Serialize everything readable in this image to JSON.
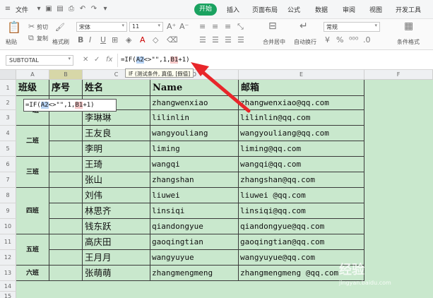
{
  "menubar": {
    "file": "文件",
    "tabs": [
      "开始",
      "插入",
      "页面布局",
      "公式",
      "数据",
      "审阅",
      "视图",
      "开发工具"
    ]
  },
  "ribbon": {
    "paste": "粘贴",
    "cut": "剪切",
    "copy": "复制",
    "format_painter": "格式刷",
    "font": "宋体",
    "size": "11",
    "merge": "合并居中",
    "wrap": "自动换行",
    "number_format": "常规",
    "cond_format": "条件格式"
  },
  "formula_bar": {
    "name_box": "SUBTOTAL",
    "fx": "fx",
    "formula_prefix": "=IF(",
    "ref_a": "A2",
    "formula_mid": "<>\"\",1,",
    "ref_b": "B1",
    "formula_suffix": "+1)"
  },
  "tooltip": "IF (测试条件, 真值, [假值]",
  "grid": {
    "columns": [
      "A",
      "B",
      "C",
      "D",
      "E",
      "F"
    ],
    "rows": [
      "1",
      "2",
      "3",
      "4",
      "5",
      "6",
      "7",
      "8",
      "9",
      "10",
      "11",
      "12",
      "13",
      "14",
      "15"
    ],
    "headers": [
      "班级",
      "序号",
      "姓名",
      "Name",
      "邮箱"
    ],
    "edit_cell": {
      "prefix": "=IF(",
      "ref_a": "A2",
      "mid": "<>\"\",1,",
      "ref_b": "B1",
      "suffix": "+1)"
    },
    "classes": [
      "一班",
      "二班",
      "三班",
      "四班",
      "五班",
      "六班"
    ],
    "data": [
      [
        "",
        "zhangwenxiao",
        "zhangwenxiao@qq.com"
      ],
      [
        "李琳琳",
        "lilinlin",
        "lilinlin@qq.com"
      ],
      [
        "王友良",
        "wangyouliang",
        "wangyouliang@qq.com"
      ],
      [
        "李明",
        "liming",
        "liming@qq.com"
      ],
      [
        "王琦",
        "wangqi",
        "wangqi@qq.com"
      ],
      [
        "张山",
        "zhangshan",
        "zhangshan@qq.com"
      ],
      [
        "刘伟",
        "liuwei",
        "liuwei @qq.com"
      ],
      [
        "林思齐",
        "linsiqi",
        "linsiqi@qq.com"
      ],
      [
        "钱东跃",
        "qiandongyue",
        "qiandongyue@qq.com"
      ],
      [
        "高庆田",
        "gaoqingtian",
        "gaoqingtian@qq.com"
      ],
      [
        "王月月",
        "wangyuyue",
        "wangyuyue@qq.com"
      ],
      [
        "张萌萌",
        "zhangmengmeng",
        "zhangmengmeng @qq.com"
      ]
    ]
  },
  "watermark": {
    "text": "经验",
    "sub": "jingyan.baidu.com"
  },
  "colors": {
    "accent": "#1aa260",
    "sheet": "#c9e8cd",
    "arrow": "#e8262a"
  }
}
